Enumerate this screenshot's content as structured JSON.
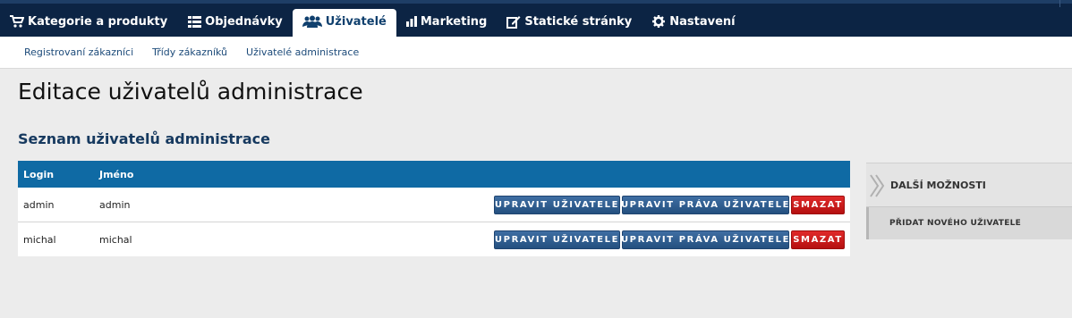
{
  "nav": {
    "items": [
      {
        "label": "Kategorie a produkty",
        "icon": "cart-icon"
      },
      {
        "label": "Objednávky",
        "icon": "list-icon"
      },
      {
        "label": "Uživatelé",
        "icon": "users-icon",
        "active": true
      },
      {
        "label": "Marketing",
        "icon": "bar-chart-icon"
      },
      {
        "label": "Statické stránky",
        "icon": "edit-icon"
      },
      {
        "label": "Nastavení",
        "icon": "gear-icon"
      }
    ]
  },
  "subnav": {
    "items": [
      "Registrovaní zákazníci",
      "Třídy zákazníků",
      "Uživatelé administrace"
    ]
  },
  "page": {
    "title": "Editace uživatelů administrace",
    "section_title": "Seznam uživatelů administrace"
  },
  "table": {
    "headers": {
      "login": "Login",
      "name": "Jméno"
    },
    "rows": [
      {
        "login": "admin",
        "name": "admin"
      },
      {
        "login": "michal",
        "name": "michal"
      }
    ],
    "actions": {
      "edit_user": "UPRAVIT UŽIVATELE",
      "edit_rights": "UPRAVIT PRÁVA UŽIVATELE",
      "delete": "SMAZAT"
    }
  },
  "side": {
    "title": "DALŠÍ MOŽNOSTI",
    "add_user": "PŘIDAT NOVÉHO UŽIVATELE"
  },
  "colors": {
    "topbar": "#0c2444",
    "table_header": "#0f6aa4",
    "button_blue": "#2e5b8d",
    "button_red": "#c81a1a"
  }
}
